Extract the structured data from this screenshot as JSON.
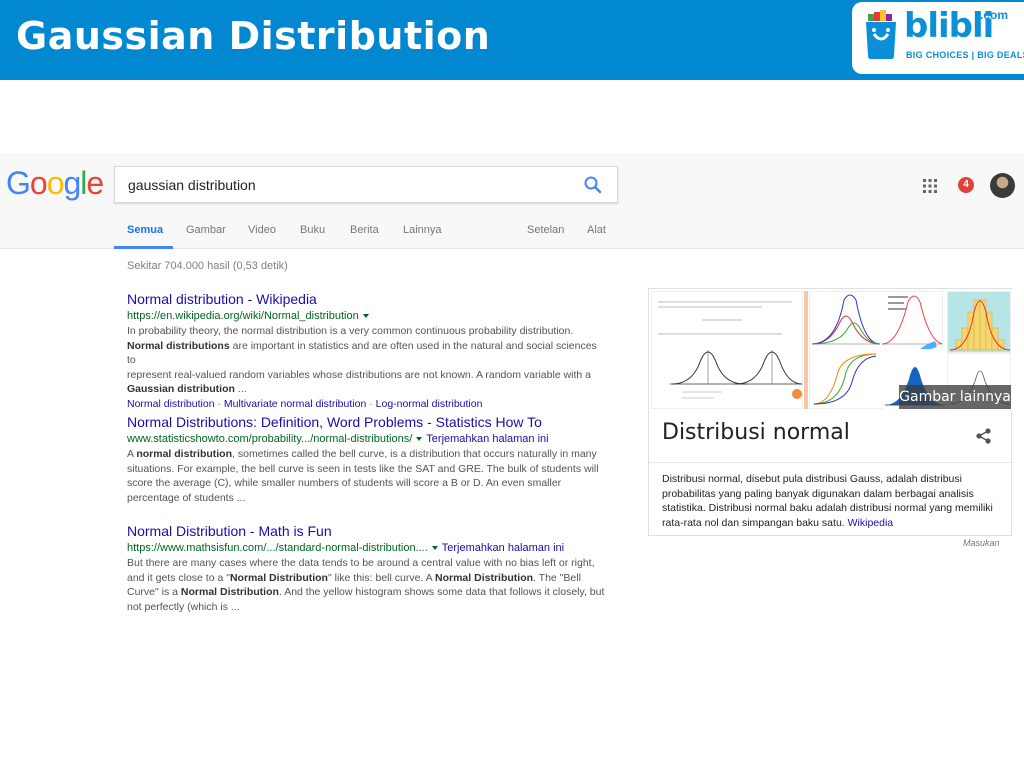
{
  "slide": {
    "title": "Gaussian Distribution",
    "brand": {
      "name": "blibli",
      "tld": ".com",
      "tagline": "BIG CHOICES | BIG DEALS",
      "color": "#0a8fd8"
    },
    "banner_color": "#0288d1"
  },
  "google": {
    "logo": [
      "G",
      "o",
      "o",
      "g",
      "l",
      "e"
    ],
    "logo_colors": [
      "#4285f4",
      "#ea4335",
      "#fbbc05",
      "#4285f4",
      "#34a853",
      "#ea4335"
    ],
    "query": "gaussian distribution",
    "notification_count": "4",
    "tabs": {
      "all": "Semua",
      "images": "Gambar",
      "video": "Video",
      "books": "Buku",
      "news": "Berita",
      "more": "Lainnya",
      "settings": "Setelan",
      "tools": "Alat"
    },
    "stats": "Sekitar 704.000 hasil (0,53 detik)",
    "results": [
      {
        "title": "Normal distribution - Wikipedia",
        "url": "https://en.wikipedia.org/wiki/Normal_distribution",
        "snippet_lines": [
          [
            {
              "t": "In probability theory, the normal distribution is a very common continuous probability distribution.",
              "b": false
            }
          ],
          [
            {
              "t": "Normal distributions",
              "b": true
            },
            {
              "t": " are important in statistics and are often used in the natural and social sciences to",
              "b": false
            }
          ],
          [
            {
              "t": "represent real-valued random variables whose distributions are not known. A random variable with a",
              "b": false
            }
          ],
          [
            {
              "t": "Gaussian distribution",
              "b": true
            },
            {
              "t": " ...",
              "b": false
            }
          ]
        ],
        "sitelinks": [
          "Normal distribution",
          "Multivariate normal distribution",
          "Log-normal distribution"
        ]
      },
      {
        "title": "Normal Distributions: Definition, Word Problems - Statistics How To",
        "url": "www.statisticshowto.com/probability.../normal-distributions/",
        "translate": "Terjemahkan halaman ini",
        "snippet_lines": [
          [
            {
              "t": "A ",
              "b": false
            },
            {
              "t": "normal distribution",
              "b": true
            },
            {
              "t": ", sometimes called the bell curve, is a distribution that occurs naturally in many",
              "b": false
            }
          ],
          [
            {
              "t": "situations. For example, the bell curve is seen in tests like the SAT and GRE. The bulk of students will",
              "b": false
            }
          ],
          [
            {
              "t": "score the average (C), while smaller numbers of students will score a B or D. An even smaller",
              "b": false
            }
          ],
          [
            {
              "t": "percentage of students ...",
              "b": false
            }
          ]
        ]
      },
      {
        "title": "Normal Distribution - Math is Fun",
        "url": "https://www.mathsisfun.com/.../standard-normal-distribution....",
        "translate": "Terjemahkan halaman ini",
        "snippet_lines": [
          [
            {
              "t": "But there are many cases where the data tends to be around a central value with no bias left or right,",
              "b": false
            }
          ],
          [
            {
              "t": "and it gets close to a \"",
              "b": false
            },
            {
              "t": "Normal Distribution",
              "b": true
            },
            {
              "t": "\" like this: bell curve. A ",
              "b": false
            },
            {
              "t": "Normal Distribution",
              "b": true
            },
            {
              "t": ". The \"Bell",
              "b": false
            }
          ],
          [
            {
              "t": "Curve\" is a ",
              "b": false
            },
            {
              "t": "Normal Distribution",
              "b": true
            },
            {
              "t": ". And the yellow histogram shows some data that follows it closely, but",
              "b": false
            }
          ],
          [
            {
              "t": "not perfectly (which is ...",
              "b": false
            }
          ]
        ]
      }
    ],
    "knowledge_panel": {
      "more_images": "Gambar lainnya",
      "title": "Distribusi normal",
      "description": "Distribusi normal, disebut pula distribusi Gauss, adalah distribusi probabilitas yang paling banyak digunakan dalam berbagai analisis statistika. Distribusi normal baku adalah distribusi normal yang memiliki rata-rata nol dan simpangan baku satu. ",
      "source": "Wikipedia",
      "feedback": "Masukan"
    }
  }
}
